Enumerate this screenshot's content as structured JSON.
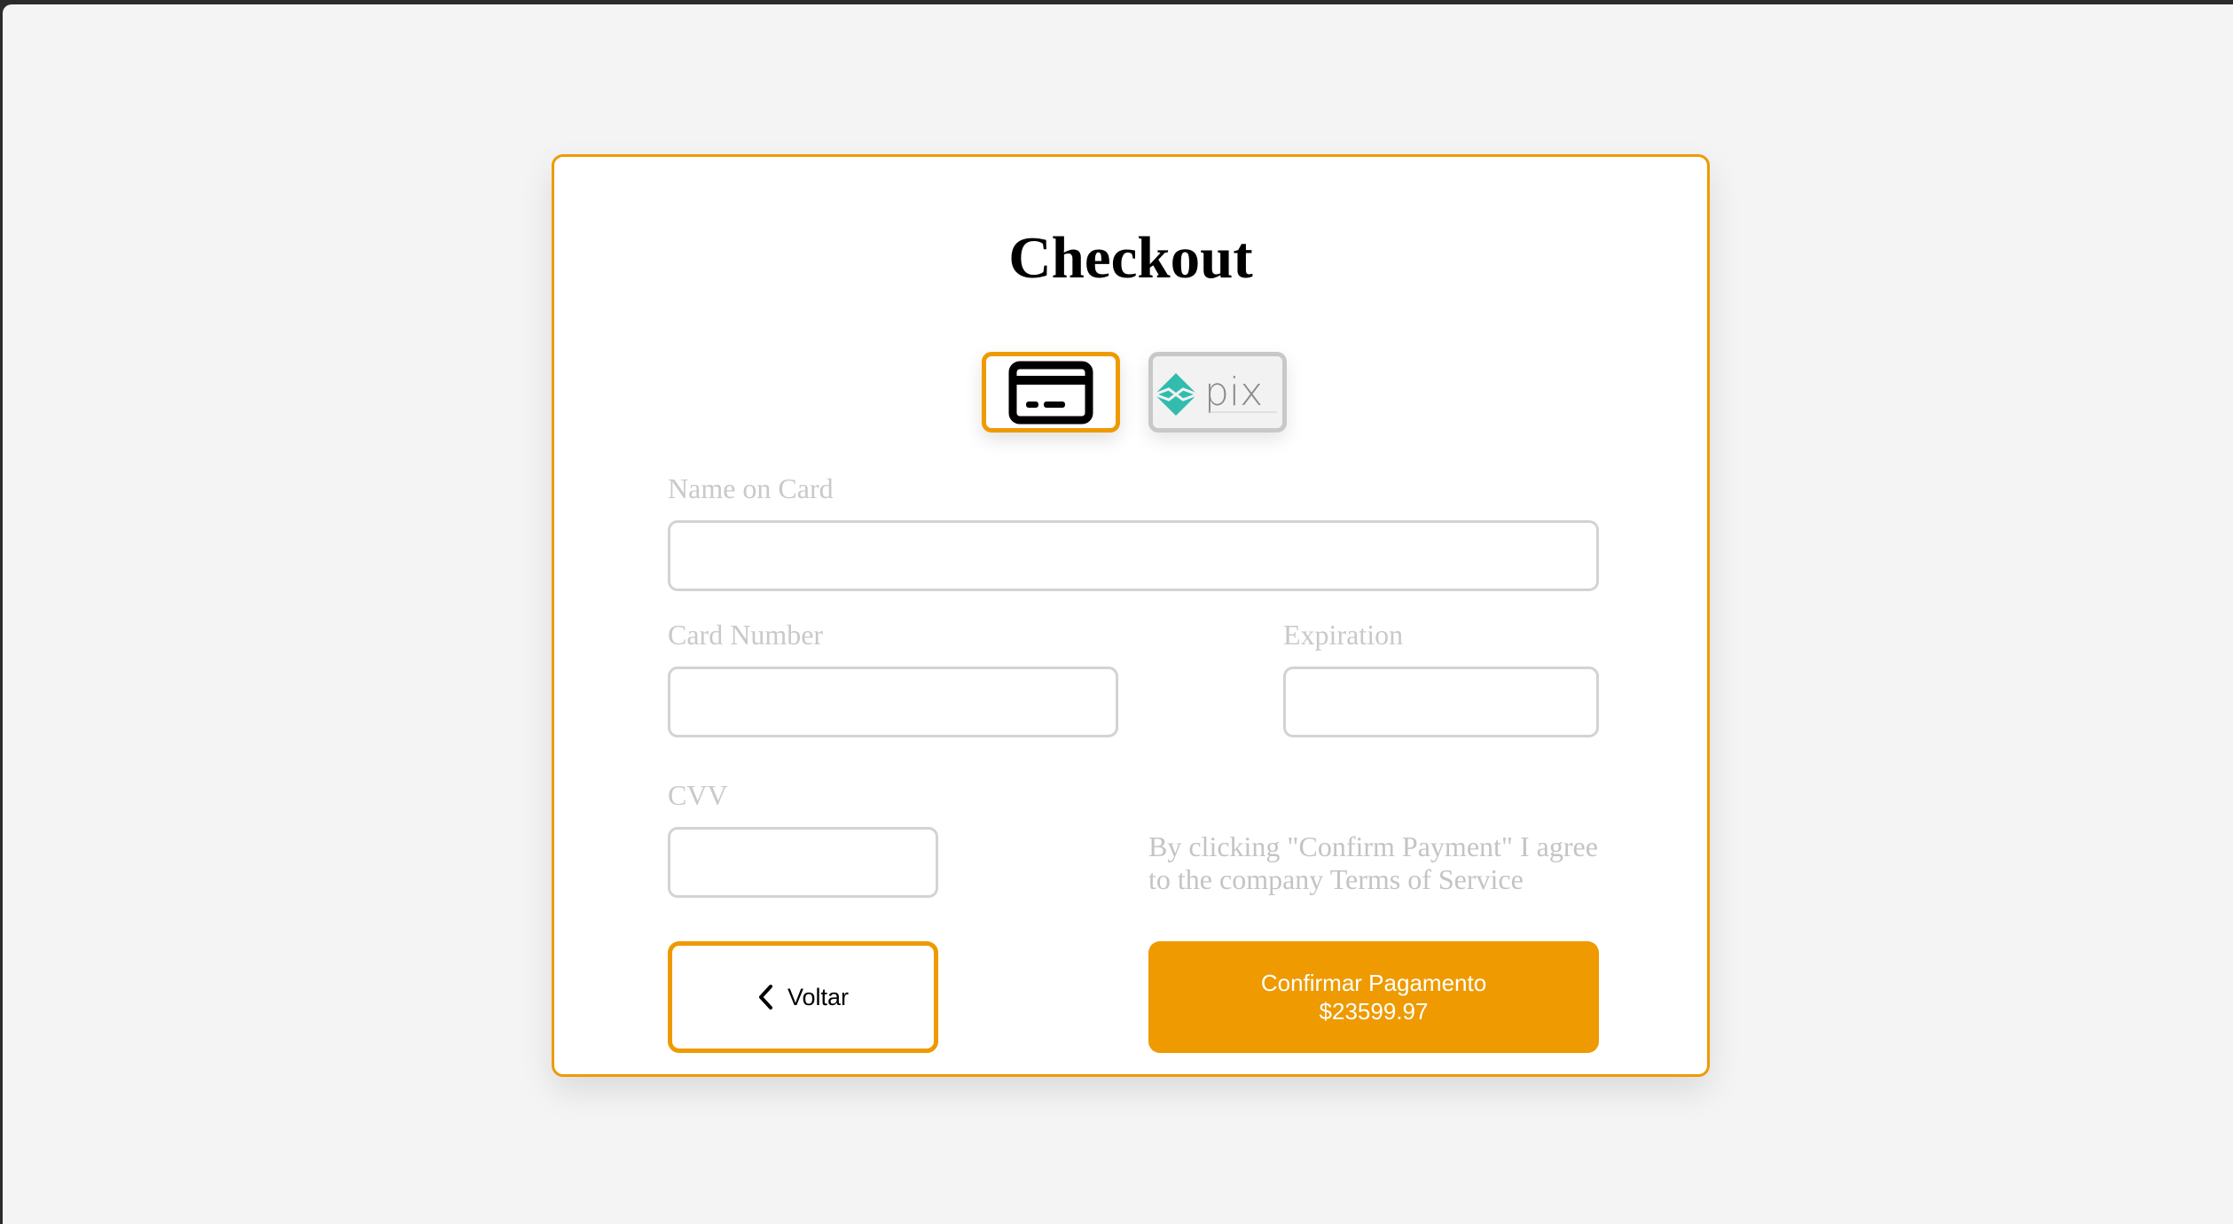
{
  "checkout": {
    "title": "Checkout",
    "payment_methods": [
      {
        "name": "credit-card",
        "icon": "credit-card-icon",
        "selected": true
      },
      {
        "name": "pix",
        "icon": "pix-logo",
        "logo_text": "pix",
        "selected": false
      }
    ],
    "fields": {
      "name_on_card": {
        "label": "Name on Card",
        "value": "",
        "placeholder": ""
      },
      "card_number": {
        "label": "Card Number",
        "value": "",
        "placeholder": ""
      },
      "expiration": {
        "label": "Expiration",
        "value": "",
        "placeholder": ""
      },
      "cvv": {
        "label": "CVV",
        "value": "",
        "placeholder": ""
      }
    },
    "terms_text": "By clicking \"Confirm Payment\" I agree to the company Terms of Service",
    "back_button": {
      "label": "Voltar",
      "icon": "chevron-left-icon"
    },
    "confirm_button": {
      "label": "Confirmar Pagamento",
      "amount": "$23599.97"
    }
  },
  "colors": {
    "accent": "#ee9a00",
    "page_background": "#f4f4f4",
    "label_text": "#c9c9c9",
    "input_border": "#d3d3d3",
    "pix_teal": "#32bcad"
  }
}
